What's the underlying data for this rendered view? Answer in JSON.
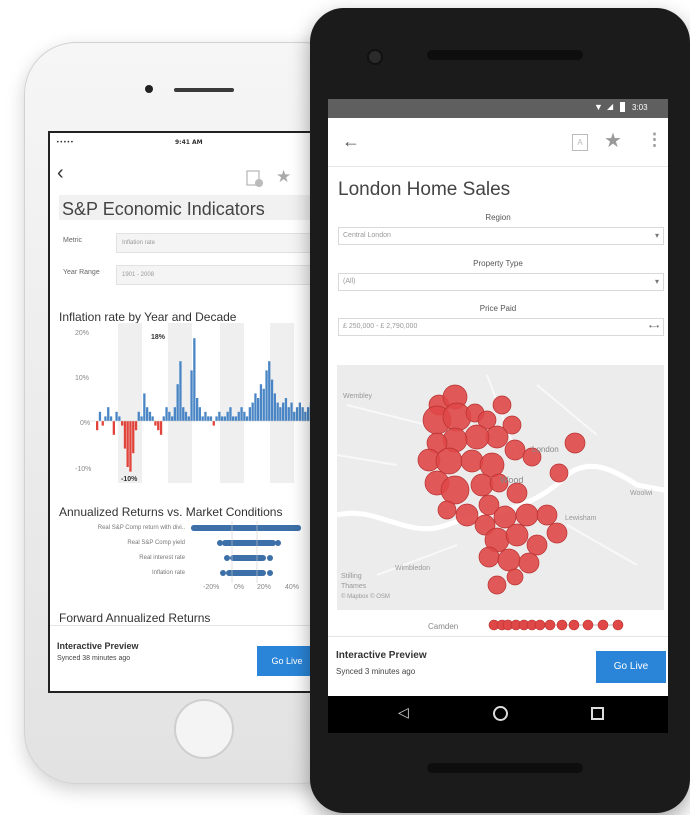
{
  "iphone": {
    "status": {
      "carrier": "•••••",
      "time": "9:41 AM"
    },
    "title": "S&P Economic Indicators",
    "metric_label": "Metric",
    "metric_value": "Inflation rate",
    "year_range_label": "Year Range",
    "year_range_value": "1901 - 2008",
    "chart1": {
      "title": "Inflation rate by Year and Decade",
      "y_ticks": [
        "20%",
        "10%",
        "0%",
        "-10%"
      ],
      "annotations": [
        "18%",
        "-10%"
      ]
    },
    "chart2": {
      "title": "Annualized Returns vs. Market Conditions",
      "rows": [
        "Real S&P Comp return with divi..",
        "Real S&P Comp yield",
        "Real interest rate",
        "Inflation rate"
      ],
      "x_ticks": [
        "-20%",
        "0%",
        "20%",
        "40%"
      ]
    },
    "chart3_title": "Forward Annualized Returns",
    "footer": {
      "title": "Interactive Preview",
      "synced": "Synced 38 minutes ago",
      "button": "Go Live"
    }
  },
  "android": {
    "status": {
      "time": "3:03"
    },
    "title": "London Home Sales",
    "region_label": "Region",
    "region_value": "Central London",
    "property_label": "Property Type",
    "property_value": "(All)",
    "price_label": "Price Paid",
    "price_value": "£ 250,000 - £ 2,790,000",
    "map_labels": [
      "Wembley",
      "London",
      "Wood",
      "Woolwi",
      "Lewisham",
      "Wimbledon",
      "Stilling",
      "Thames",
      "© Mapbox © OSM"
    ],
    "row_label": "Camden",
    "footer": {
      "title": "Interactive Preview",
      "synced": "Synced 3 minutes ago",
      "button": "Go Live"
    }
  },
  "colors": {
    "accent": "#2a85d8",
    "bar_positive": "#4a86c5",
    "bar_negative": "#e2433a",
    "map_bubble": "#e04848"
  }
}
